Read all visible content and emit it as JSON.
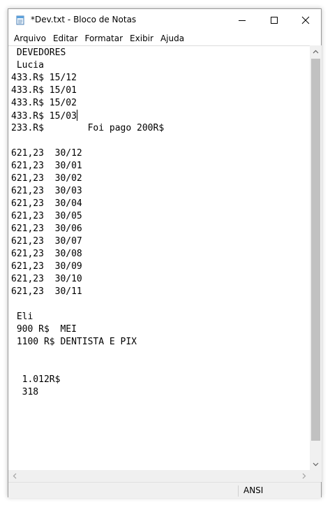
{
  "window": {
    "title": "*Dev.txt - Bloco de Notas"
  },
  "menu": {
    "items": [
      "Arquivo",
      "Editar",
      "Formatar",
      "Exibir",
      "Ajuda"
    ]
  },
  "editor": {
    "lines": [
      " DEVEDORES",
      " Lucia",
      "433.R$ 15/12",
      "433.R$ 15/01",
      "433.R$ 15/02",
      "433.R$ 15/03",
      "233.R$        Foi pago 200R$",
      "",
      "621,23  30/12",
      "621,23  30/01",
      "621,23  30/02",
      "621,23  30/03",
      "621,23  30/04",
      "621,23  30/05",
      "621,23  30/06",
      "621,23  30/07",
      "621,23  30/08",
      "621,23  30/09",
      "621,23  30/10",
      "621,23  30/11",
      "",
      " Eli",
      " 900 R$  MEI",
      " 1100 R$ DENTISTA E PIX",
      "",
      "",
      "  1.012R$",
      "  318"
    ],
    "caret_line": 5
  },
  "statusbar": {
    "encoding": "ANSI"
  },
  "icons": {
    "app": "notepad-icon",
    "minimize": "minimize-icon",
    "maximize": "maximize-icon",
    "close": "close-icon"
  }
}
